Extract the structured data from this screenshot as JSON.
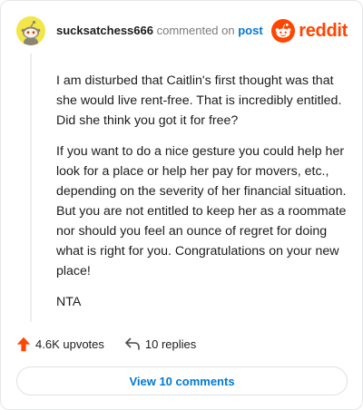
{
  "comment": {
    "username": "sucksatchess666",
    "action_text": "commented on",
    "link_text": "post",
    "paragraphs": [
      "I am disturbed that Caitlin's first thought was that she would live rent-free. That is incredibly entitled. Did she think you got it for free?",
      "If you want to do a nice gesture you could help her look for a place or help her pay for movers, etc., depending on the severity of her financial situation. But you are not entitled to keep her as a roommate nor should you feel an ounce of regret for doing what is right for you. Congratulations on your new place!",
      "NTA"
    ]
  },
  "brand": {
    "wordmark": "reddit",
    "icon": "reddit-alien-icon",
    "color": "#ff4500"
  },
  "actions": {
    "upvotes_label": "4.6K upvotes",
    "replies_label": "10 replies",
    "upvote_icon": "upvote-arrow-icon",
    "reply_icon": "reply-arrow-icon"
  },
  "footer": {
    "view_comments_label": "View 10 comments"
  },
  "colors": {
    "link": "#0079d3",
    "upvote": "#ff4500",
    "muted": "#7c7c7c",
    "avatar_bg": "#f2e64a"
  }
}
